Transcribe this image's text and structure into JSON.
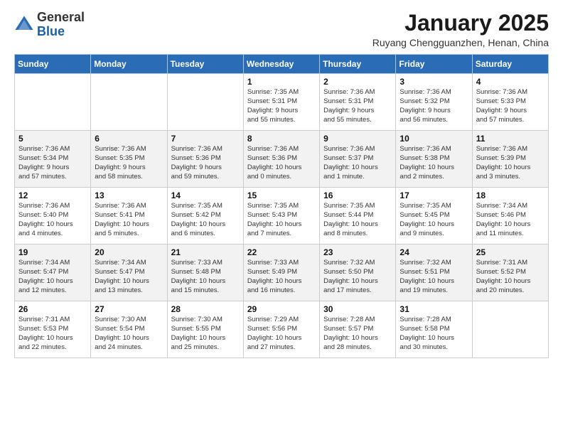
{
  "header": {
    "logo_general": "General",
    "logo_blue": "Blue",
    "title": "January 2025",
    "subtitle": "Ruyang Chengguanzhen, Henan, China"
  },
  "days_of_week": [
    "Sunday",
    "Monday",
    "Tuesday",
    "Wednesday",
    "Thursday",
    "Friday",
    "Saturday"
  ],
  "weeks": [
    [
      {
        "day": "",
        "text": ""
      },
      {
        "day": "",
        "text": ""
      },
      {
        "day": "",
        "text": ""
      },
      {
        "day": "1",
        "text": "Sunrise: 7:35 AM\nSunset: 5:31 PM\nDaylight: 9 hours\nand 55 minutes."
      },
      {
        "day": "2",
        "text": "Sunrise: 7:36 AM\nSunset: 5:31 PM\nDaylight: 9 hours\nand 55 minutes."
      },
      {
        "day": "3",
        "text": "Sunrise: 7:36 AM\nSunset: 5:32 PM\nDaylight: 9 hours\nand 56 minutes."
      },
      {
        "day": "4",
        "text": "Sunrise: 7:36 AM\nSunset: 5:33 PM\nDaylight: 9 hours\nand 57 minutes."
      }
    ],
    [
      {
        "day": "5",
        "text": "Sunrise: 7:36 AM\nSunset: 5:34 PM\nDaylight: 9 hours\nand 57 minutes."
      },
      {
        "day": "6",
        "text": "Sunrise: 7:36 AM\nSunset: 5:35 PM\nDaylight: 9 hours\nand 58 minutes."
      },
      {
        "day": "7",
        "text": "Sunrise: 7:36 AM\nSunset: 5:36 PM\nDaylight: 9 hours\nand 59 minutes."
      },
      {
        "day": "8",
        "text": "Sunrise: 7:36 AM\nSunset: 5:36 PM\nDaylight: 10 hours\nand 0 minutes."
      },
      {
        "day": "9",
        "text": "Sunrise: 7:36 AM\nSunset: 5:37 PM\nDaylight: 10 hours\nand 1 minute."
      },
      {
        "day": "10",
        "text": "Sunrise: 7:36 AM\nSunset: 5:38 PM\nDaylight: 10 hours\nand 2 minutes."
      },
      {
        "day": "11",
        "text": "Sunrise: 7:36 AM\nSunset: 5:39 PM\nDaylight: 10 hours\nand 3 minutes."
      }
    ],
    [
      {
        "day": "12",
        "text": "Sunrise: 7:36 AM\nSunset: 5:40 PM\nDaylight: 10 hours\nand 4 minutes."
      },
      {
        "day": "13",
        "text": "Sunrise: 7:36 AM\nSunset: 5:41 PM\nDaylight: 10 hours\nand 5 minutes."
      },
      {
        "day": "14",
        "text": "Sunrise: 7:35 AM\nSunset: 5:42 PM\nDaylight: 10 hours\nand 6 minutes."
      },
      {
        "day": "15",
        "text": "Sunrise: 7:35 AM\nSunset: 5:43 PM\nDaylight: 10 hours\nand 7 minutes."
      },
      {
        "day": "16",
        "text": "Sunrise: 7:35 AM\nSunset: 5:44 PM\nDaylight: 10 hours\nand 8 minutes."
      },
      {
        "day": "17",
        "text": "Sunrise: 7:35 AM\nSunset: 5:45 PM\nDaylight: 10 hours\nand 9 minutes."
      },
      {
        "day": "18",
        "text": "Sunrise: 7:34 AM\nSunset: 5:46 PM\nDaylight: 10 hours\nand 11 minutes."
      }
    ],
    [
      {
        "day": "19",
        "text": "Sunrise: 7:34 AM\nSunset: 5:47 PM\nDaylight: 10 hours\nand 12 minutes."
      },
      {
        "day": "20",
        "text": "Sunrise: 7:34 AM\nSunset: 5:47 PM\nDaylight: 10 hours\nand 13 minutes."
      },
      {
        "day": "21",
        "text": "Sunrise: 7:33 AM\nSunset: 5:48 PM\nDaylight: 10 hours\nand 15 minutes."
      },
      {
        "day": "22",
        "text": "Sunrise: 7:33 AM\nSunset: 5:49 PM\nDaylight: 10 hours\nand 16 minutes."
      },
      {
        "day": "23",
        "text": "Sunrise: 7:32 AM\nSunset: 5:50 PM\nDaylight: 10 hours\nand 17 minutes."
      },
      {
        "day": "24",
        "text": "Sunrise: 7:32 AM\nSunset: 5:51 PM\nDaylight: 10 hours\nand 19 minutes."
      },
      {
        "day": "25",
        "text": "Sunrise: 7:31 AM\nSunset: 5:52 PM\nDaylight: 10 hours\nand 20 minutes."
      }
    ],
    [
      {
        "day": "26",
        "text": "Sunrise: 7:31 AM\nSunset: 5:53 PM\nDaylight: 10 hours\nand 22 minutes."
      },
      {
        "day": "27",
        "text": "Sunrise: 7:30 AM\nSunset: 5:54 PM\nDaylight: 10 hours\nand 24 minutes."
      },
      {
        "day": "28",
        "text": "Sunrise: 7:30 AM\nSunset: 5:55 PM\nDaylight: 10 hours\nand 25 minutes."
      },
      {
        "day": "29",
        "text": "Sunrise: 7:29 AM\nSunset: 5:56 PM\nDaylight: 10 hours\nand 27 minutes."
      },
      {
        "day": "30",
        "text": "Sunrise: 7:28 AM\nSunset: 5:57 PM\nDaylight: 10 hours\nand 28 minutes."
      },
      {
        "day": "31",
        "text": "Sunrise: 7:28 AM\nSunset: 5:58 PM\nDaylight: 10 hours\nand 30 minutes."
      },
      {
        "day": "",
        "text": ""
      }
    ]
  ]
}
